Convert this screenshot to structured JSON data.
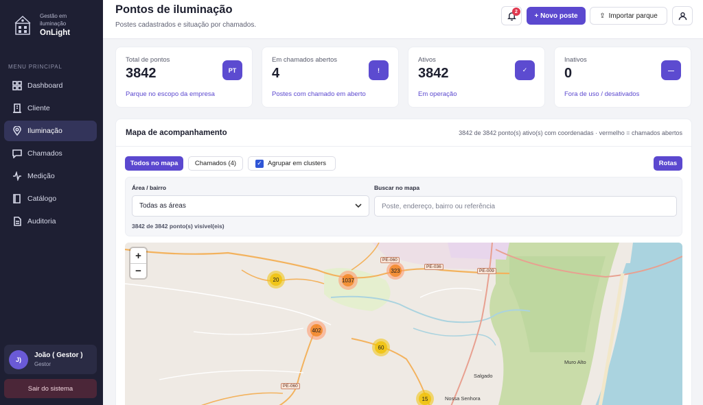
{
  "brand": {
    "subtitle": "Gestão em iluminação",
    "name": "OnLight"
  },
  "sidebar": {
    "heading": "MENU PRINCIPAL",
    "items": [
      {
        "label": "Dashboard",
        "icon": "dashboard-icon"
      },
      {
        "label": "Cliente",
        "icon": "building-icon"
      },
      {
        "label": "Iluminação",
        "icon": "location-pin-icon"
      },
      {
        "label": "Chamados",
        "icon": "chat-icon"
      },
      {
        "label": "Medição",
        "icon": "activity-icon"
      },
      {
        "label": "Catálogo",
        "icon": "book-icon"
      },
      {
        "label": "Auditoria",
        "icon": "document-icon"
      }
    ],
    "active_index": 2
  },
  "user": {
    "initials": "J)",
    "name": "João ( Gestor )",
    "role": "Gestor"
  },
  "logout_label": "Sair do sistema",
  "header": {
    "title": "Pontos de iluminação",
    "subtitle": "Postes cadastrados e situação por chamados.",
    "notifications": "2",
    "new_label": "+ Novo poste",
    "import_label": "Importar parque"
  },
  "stats": [
    {
      "label": "Total de pontos",
      "value": "3842",
      "note": "Parque no escopo da empresa",
      "icon_text": "PT"
    },
    {
      "label": "Em chamados abertos",
      "value": "4",
      "note": "Postes com chamado em aberto",
      "icon_text": "!"
    },
    {
      "label": "Ativos",
      "value": "3842",
      "note": "Em operação",
      "icon_text": "✓"
    },
    {
      "label": "Inativos",
      "value": "0",
      "note": "Fora de uso / desativados",
      "icon_text": "—"
    }
  ],
  "map_panel": {
    "title": "Mapa de acompanhamento",
    "meta": "3842 de 3842 ponto(s) ativo(s) com coordenadas · vermelho = chamados abertos",
    "chip_all": "Todos no mapa",
    "chip_calls": "Chamados (4)",
    "chip_cluster": "Agrupar em clusters",
    "cluster_checked": true,
    "routes": "Rotas",
    "area_label": "Área / bairro",
    "area_value": "Todas as áreas",
    "search_label": "Buscar no mapa",
    "search_placeholder": "Poste, endereço, bairro ou referência",
    "visible_count": "3842 de 3842 ponto(s) visível(eis)"
  },
  "map": {
    "zoom_in": "+",
    "zoom_out": "−",
    "clusters": [
      "20",
      "1037",
      "323",
      "402",
      "60",
      "15"
    ],
    "labels": [
      "Salgado",
      "Muro Alto",
      "Nossa Senhora"
    ],
    "shields": [
      "PE-060",
      "PE-036",
      "PE-009",
      "PE-060"
    ]
  },
  "colors": {
    "accent": "#5b48cf",
    "sidebar": "#1e1f33",
    "danger": "#e0384f"
  }
}
